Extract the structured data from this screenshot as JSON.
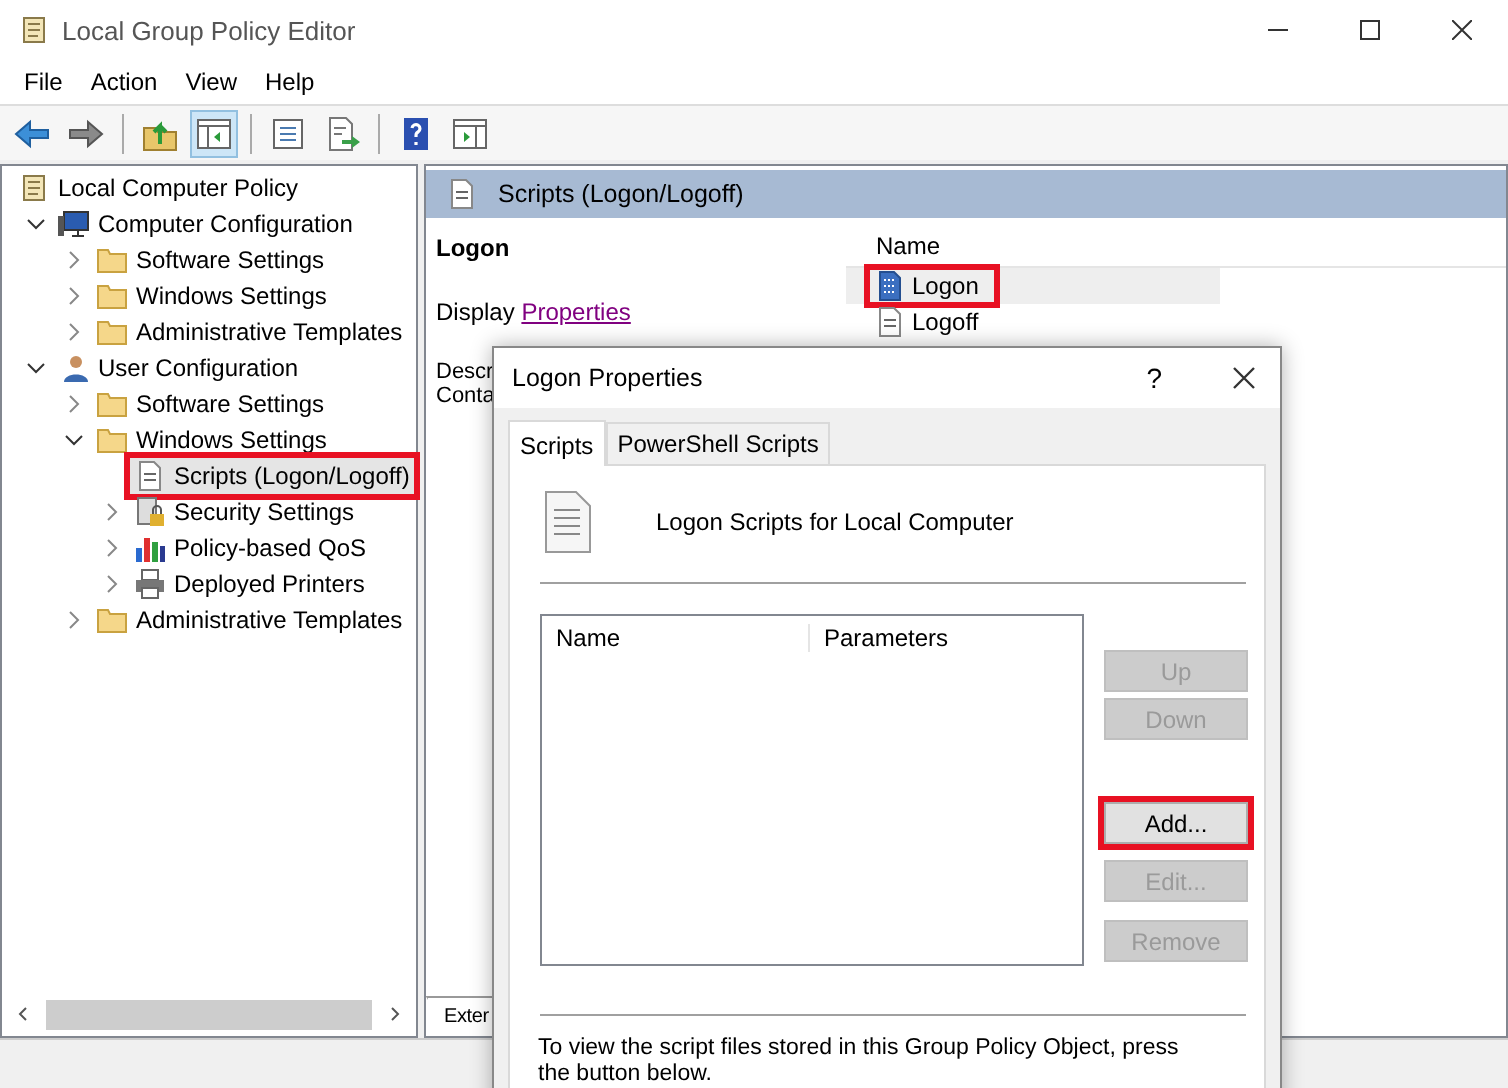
{
  "window": {
    "title": "Local Group Policy Editor"
  },
  "menu": [
    "File",
    "Action",
    "View",
    "Help"
  ],
  "toolbar": [
    {
      "kind": "back",
      "pressed": false
    },
    {
      "kind": "forward",
      "pressed": false
    },
    {
      "kind": "separator"
    },
    {
      "kind": "up",
      "pressed": false
    },
    {
      "kind": "tree",
      "pressed": true
    },
    {
      "kind": "separator"
    },
    {
      "kind": "properties",
      "pressed": false
    },
    {
      "kind": "export",
      "pressed": false
    },
    {
      "kind": "separator"
    },
    {
      "kind": "help",
      "pressed": false
    },
    {
      "kind": "view",
      "pressed": false
    }
  ],
  "tree": [
    {
      "label": "Local Computer Policy",
      "kind": "policy",
      "selected": false,
      "highlighted": false,
      "children": [
        {
          "label": "Computer Configuration",
          "kind": "computer",
          "expanded": true,
          "selected": false,
          "highlighted": false,
          "children": [
            {
              "label": "Software Settings",
              "kind": "folder",
              "expanded": false,
              "selected": false,
              "highlighted": false
            },
            {
              "label": "Windows Settings",
              "kind": "folder",
              "expanded": false,
              "selected": false,
              "highlighted": false
            },
            {
              "label": "Administrative Templates",
              "kind": "folder",
              "expanded": false,
              "selected": false,
              "highlighted": false
            }
          ]
        },
        {
          "label": "User Configuration",
          "kind": "user",
          "expanded": true,
          "selected": false,
          "highlighted": false,
          "children": [
            {
              "label": "Software Settings",
              "kind": "folder",
              "expanded": false,
              "selected": false,
              "highlighted": false
            },
            {
              "label": "Windows Settings",
              "kind": "folder",
              "expanded": true,
              "selected": false,
              "highlighted": false,
              "children": [
                {
                  "label": "Scripts (Logon/Logoff)",
                  "kind": "script",
                  "selected": true,
                  "highlighted": true
                },
                {
                  "label": "Security Settings",
                  "kind": "security",
                  "expanded": false,
                  "selected": false,
                  "highlighted": false
                },
                {
                  "label": "Policy-based QoS",
                  "kind": "chart",
                  "expanded": false,
                  "selected": false,
                  "highlighted": false
                },
                {
                  "label": "Deployed Printers",
                  "kind": "printer",
                  "expanded": false,
                  "selected": false,
                  "highlighted": false
                }
              ]
            },
            {
              "label": "Administrative Templates",
              "kind": "folder",
              "expanded": false,
              "selected": false,
              "highlighted": false
            }
          ]
        }
      ]
    }
  ],
  "details": {
    "heading": "Scripts (Logon/Logoff)",
    "item_title": "Logon",
    "display_prefix": "Display",
    "display_link": "Properties",
    "description_label": "Descr",
    "contains_label": "Conta"
  },
  "list": {
    "column": "Name",
    "rows": [
      {
        "label": "Logon",
        "selected": true,
        "highlighted": true
      },
      {
        "label": "Logoff",
        "selected": false,
        "highlighted": false
      }
    ]
  },
  "bottom_tabs": [
    {
      "label": "Exter"
    }
  ],
  "dialog": {
    "title": "Logon Properties",
    "help": "?",
    "tabs": [
      {
        "label": "Scripts",
        "selected": true
      },
      {
        "label": "PowerShell Scripts",
        "selected": false
      }
    ],
    "heading": "Logon Scripts for Local Computer",
    "columns": [
      "Name",
      "Parameters"
    ],
    "buttons": [
      {
        "label": "Up",
        "disabled": true,
        "highlighted": false
      },
      {
        "label": "Down",
        "disabled": true,
        "highlighted": false
      },
      {
        "label": "Add...",
        "disabled": false,
        "highlighted": true
      },
      {
        "label": "Edit...",
        "disabled": true,
        "highlighted": false
      },
      {
        "label": "Remove",
        "disabled": true,
        "highlighted": false
      }
    ],
    "note": "To view the script files stored in this Group Policy Object, press the button below."
  }
}
